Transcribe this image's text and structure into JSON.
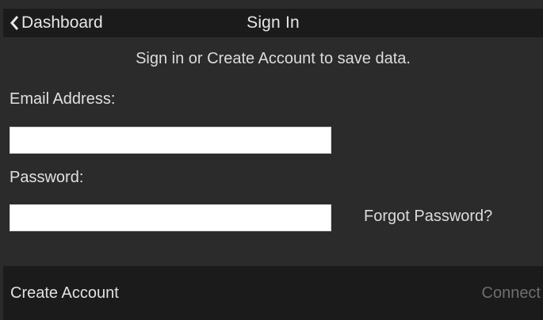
{
  "header": {
    "back_label": "Dashboard",
    "back_icon": "chevron-left-icon",
    "title": "Sign In"
  },
  "main": {
    "intro_text": "Sign in or Create Account to save data.",
    "email": {
      "label": "Email Address:",
      "value": ""
    },
    "password": {
      "label": "Password:",
      "value": ""
    },
    "forgot_label": "Forgot Password?"
  },
  "footer": {
    "create_account_label": "Create Account",
    "connect_label": "Connect"
  },
  "colors": {
    "bar_background": "#1b1b1b",
    "content_background": "#2b2b2b",
    "text": "#e0e0e0",
    "disabled_text": "#6e6e6e"
  }
}
